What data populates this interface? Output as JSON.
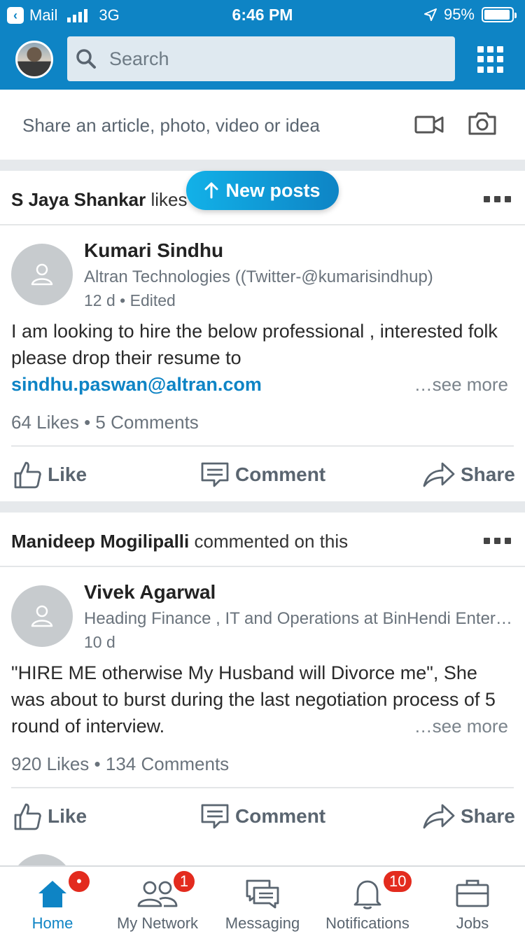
{
  "status_bar": {
    "back_app": "Mail",
    "network": "3G",
    "time": "6:46 PM",
    "battery": "95%",
    "battery_level": 0.95
  },
  "header": {
    "search_placeholder": "Search"
  },
  "share": {
    "prompt": "Share an article, photo, video or idea"
  },
  "new_posts": "New posts",
  "posts": [
    {
      "context_name": "S Jaya Shankar",
      "context_action": "likes this",
      "author": "Kumari Sindhu",
      "headline": "Altran Technologies ((Twitter-@kumarisindhup)",
      "time": "12 d • Edited",
      "text": "I am looking to hire the below professional , interested folk please drop  their resume  to",
      "link": "sindhu.paswan@altran.com",
      "see_more": "…see more",
      "likes": "64 Likes",
      "comments": "5 Comments"
    },
    {
      "context_name": "Manideep Mogilipalli",
      "context_action": "commented on this",
      "author": "Vivek Agarwal",
      "headline": "Heading Finance , IT and Operations at BinHendi Enterprises",
      "time": "10 d",
      "text": "\"HIRE ME otherwise My Husband will Divorce me\", She was about to burst during the last negotiation process of 5 round of interview.",
      "see_more": "…see more",
      "likes": "920 Likes",
      "comments": "134 Comments"
    }
  ],
  "actions": {
    "like": "Like",
    "comment": "Comment",
    "share": "Share"
  },
  "tabs": [
    {
      "label": "Home",
      "badge": "•"
    },
    {
      "label": "My Network",
      "badge": "1"
    },
    {
      "label": "Messaging",
      "badge": ""
    },
    {
      "label": "Notifications",
      "badge": "10"
    },
    {
      "label": "Jobs",
      "badge": ""
    }
  ],
  "colors": {
    "brand": "#0e84c5",
    "badge": "#e32b1e"
  }
}
